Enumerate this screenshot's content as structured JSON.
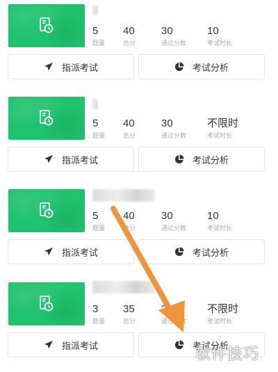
{
  "exams": [
    {
      "title": "",
      "stats": [
        {
          "value": "5",
          "label": "题量"
        },
        {
          "value": "40",
          "label": "总分"
        },
        {
          "value": "30",
          "label": "通过分数"
        },
        {
          "value": "10",
          "label": "考试时长"
        }
      ],
      "assign_label": "指派考试",
      "analysis_label": "考试分析"
    },
    {
      "title": "",
      "stats": [
        {
          "value": "5",
          "label": "题量"
        },
        {
          "value": "40",
          "label": "总分"
        },
        {
          "value": "30",
          "label": "通过分数"
        },
        {
          "value": "不限时",
          "label": "考试时长"
        }
      ],
      "assign_label": "指派考试",
      "analysis_label": "考试分析"
    },
    {
      "title": "",
      "stats": [
        {
          "value": "5",
          "label": "题量"
        },
        {
          "value": "40",
          "label": "总分"
        },
        {
          "value": "30",
          "label": "通过分数"
        },
        {
          "value": "10",
          "label": "考试时长"
        }
      ],
      "assign_label": "指派考试",
      "analysis_label": "考试分析"
    },
    {
      "title": "",
      "stats": [
        {
          "value": "3",
          "label": "题量"
        },
        {
          "value": "35",
          "label": "总分"
        },
        {
          "value": "30",
          "label": "通过分数"
        },
        {
          "value": "不限时",
          "label": "考试时长"
        }
      ],
      "assign_label": "指派考试",
      "analysis_label": "考试分析"
    }
  ],
  "icons": {
    "thumbnail": "exam-paper-clock-icon",
    "assign": "paper-plane-icon",
    "analysis": "pie-chart-icon"
  },
  "colors": {
    "thumbnail_green": "#1fc26e",
    "arrow_orange": "#f0943c"
  },
  "watermark": "软件技巧"
}
